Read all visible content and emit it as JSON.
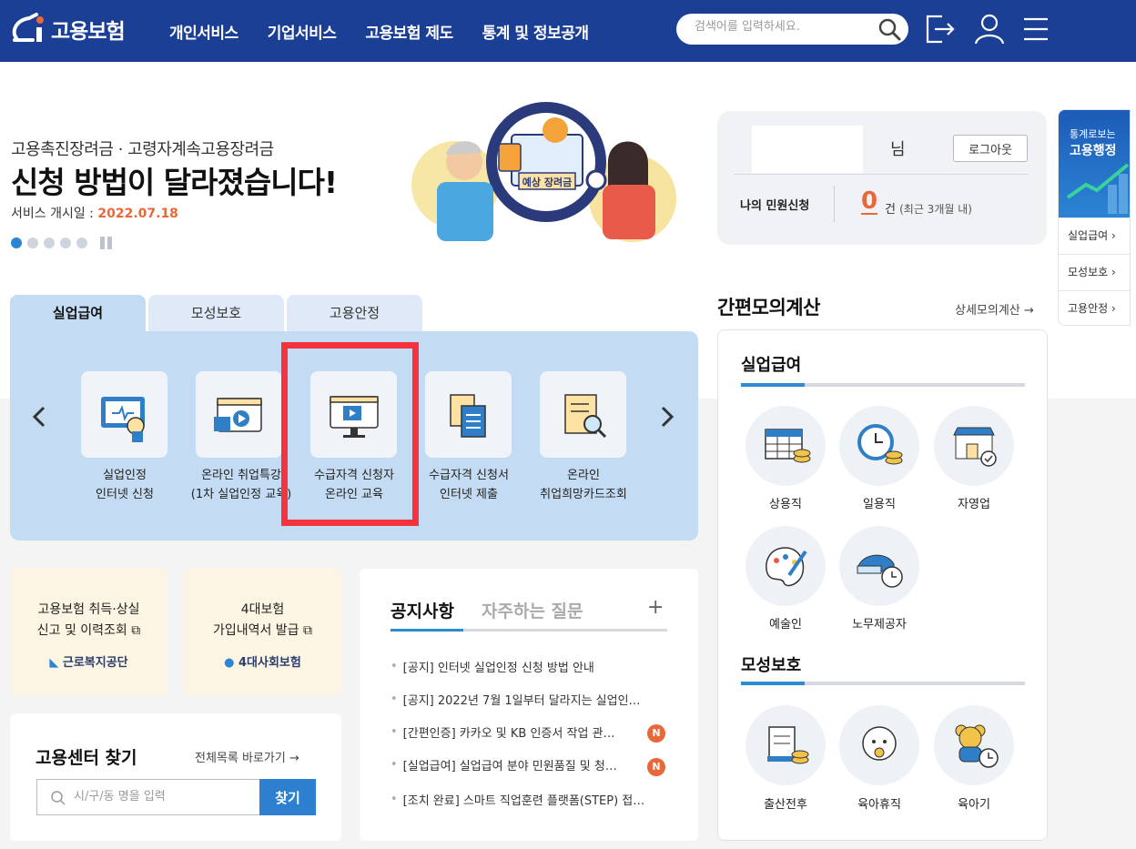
{
  "header": {
    "logo_text": "고용보험",
    "nav": [
      "개인서비스",
      "기업서비스",
      "고용보험 제도",
      "통계 및 정보공개"
    ],
    "search_placeholder": "검색어를 입력하세요."
  },
  "banner": {
    "subtitle": "고용촉진장려금 · 고령자계속고용장려금",
    "title": "신청 방법이 달라졌습니다!",
    "date_label": "서비스 개시일 : ",
    "date_value": "2022.07.18",
    "illustration_text": "예상 장려금",
    "active_dot": 1,
    "dot_count": 5
  },
  "user_card": {
    "suffix": "님",
    "logout_label": "로그아웃",
    "minwon_label": "나의 민원신청",
    "count": "0",
    "count_unit": "건",
    "count_note": "(최근 3개월 내)"
  },
  "side_menu": {
    "top_line1": "통계로보는",
    "top_line2": "고용행정",
    "items": [
      "실업급여",
      "모성보호",
      "고용안정"
    ]
  },
  "service_tabs": {
    "tabs": [
      "실업급여",
      "모성보호",
      "고용안정"
    ],
    "items": [
      {
        "line1": "실업인정",
        "line2": "인터넷 신청"
      },
      {
        "line1": "온라인 취업특강",
        "line2": "(1차 실업인정 교육)"
      },
      {
        "line1": "수급자격 신청자",
        "line2": "온라인 교육"
      },
      {
        "line1": "수급자격 신청서",
        "line2": "인터넷 제출"
      },
      {
        "line1": "온라인",
        "line2": "취업희망카드조회"
      }
    ]
  },
  "calc": {
    "title": "간편모의계산",
    "link": "상세모의계산",
    "section1": "실업급여",
    "section1_items": [
      "상용직",
      "일용직",
      "자영업",
      "예술인",
      "노무제공자"
    ],
    "section2": "모성보호",
    "section2_items": [
      "출산전후",
      "육아휴직",
      "육아기"
    ]
  },
  "quick_boxes": [
    {
      "line1": "고용보험 취득·상실",
      "line2": "신고 및 이력조회",
      "org": "근로복지공단"
    },
    {
      "line1": "4대보험",
      "line2": "가입내역서 발급",
      "org": "4대사회보험"
    }
  ],
  "center_finder": {
    "title": "고용센터 찾기",
    "link": "전체목록 바로가기",
    "placeholder": "시/구/동 명을 입력",
    "button": "찾기"
  },
  "notice": {
    "tab_active": "공지사항",
    "tab_inactive": "자주하는 질문",
    "more": "+",
    "items": [
      {
        "text": "[공지] 인터넷 실업인정 신청 방법 안내",
        "badge": ""
      },
      {
        "text": "[공지] 2022년 7월 1일부터 달라지는 실업인…",
        "badge": ""
      },
      {
        "text": "[간편인증] 카카오 및 KB 인증서 작업 관…",
        "badge": "N"
      },
      {
        "text": "[실업급여] 실업급여 분야 민원품질 및 청…",
        "badge": "N"
      },
      {
        "text": "[조치 완료] 스마트 직업훈련 플랫폼(STEP) 접…",
        "badge": ""
      }
    ]
  },
  "colors": {
    "header_bg": "#1b3f95",
    "accent_orange": "#e8683a",
    "accent_blue": "#2d8bd1",
    "highlight_red": "#f5333f",
    "tab_panel_bg": "#c4dcf3"
  }
}
